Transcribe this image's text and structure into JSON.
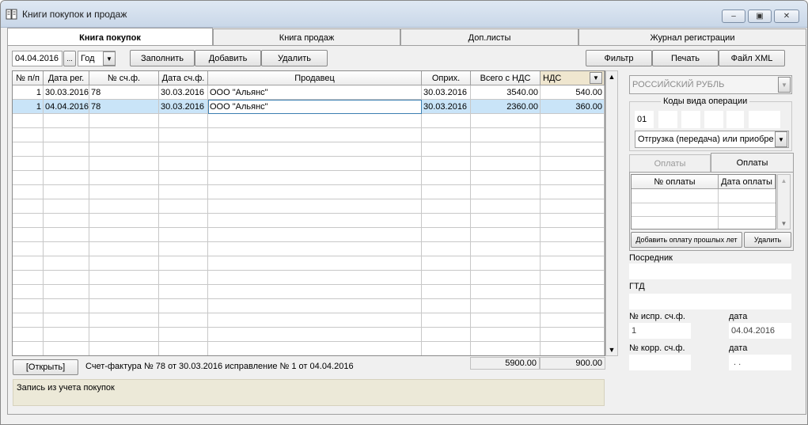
{
  "window": {
    "title": "Книги покупок и продаж",
    "controls": [
      "‒",
      "▣",
      "✕"
    ]
  },
  "tabs": [
    {
      "label": "Книга покупок",
      "active": true
    },
    {
      "label": "Книга продаж",
      "active": false
    },
    {
      "label": "Доп.листы",
      "active": false
    },
    {
      "label": "Журнал регистрации",
      "active": false
    }
  ],
  "toolbar": {
    "date_value": "04.04.2016",
    "date_picker_label": "...",
    "period_value": "Год",
    "fill_label": "Заполнить",
    "add_label": "Добавить",
    "delete_label": "Удалить",
    "filter_label": "Фильтр",
    "print_label": "Печать",
    "xml_label": "Файл XML"
  },
  "grid": {
    "columns": [
      "№ п/п",
      "Дата рег.",
      "№ сч.ф.",
      "Дата сч.ф.",
      "Продавец",
      "Оприх.",
      "Всего с НДС",
      "НДС"
    ],
    "rows": [
      [
        "1",
        "30.03.2016",
        "78",
        "30.03.2016",
        "ООО \"Альянс\"",
        "30.03.2016",
        "3540.00",
        "540.00"
      ],
      [
        "1",
        "04.04.2016",
        "78",
        "30.03.2016",
        "ООО \"Альянс\"",
        "30.03.2016",
        "2360.00",
        "360.00"
      ]
    ],
    "total_with_vat": "5900.00",
    "total_vat": "900.00"
  },
  "footer": {
    "open_label": "[Открыть]",
    "invoice_info": "Счет-фактура № 78 от 30.03.2016  исправление № 1 от 04.04.2016",
    "note": "Запись из учета покупок"
  },
  "right_panel": {
    "currency": "РОССИЙСКИЙ РУБЛЬ",
    "op_codes_title": "Коды вида операции",
    "op_code_1": "01",
    "op_description": "Отгрузка (передача) или приобре",
    "payments_tab_inactive": "Оплаты",
    "payments_tab_active": "Оплаты",
    "payments_columns": [
      "№ оплаты",
      "Дата оплаты"
    ],
    "add_past_payment_label": "Добавить оплату прошлых лет",
    "delete_payment_label": "Удалить",
    "intermediary_label": "Посредник",
    "gtd_label": "ГТД",
    "corr_inv_label": "№ испр. сч.ф.",
    "corr_inv_value": "1",
    "date_label_1": "дата",
    "date_value_1": "04.04.2016",
    "adj_inv_label": "№ корр. сч.ф.",
    "date_label_2": "дата",
    "date_value_2": " . ."
  }
}
